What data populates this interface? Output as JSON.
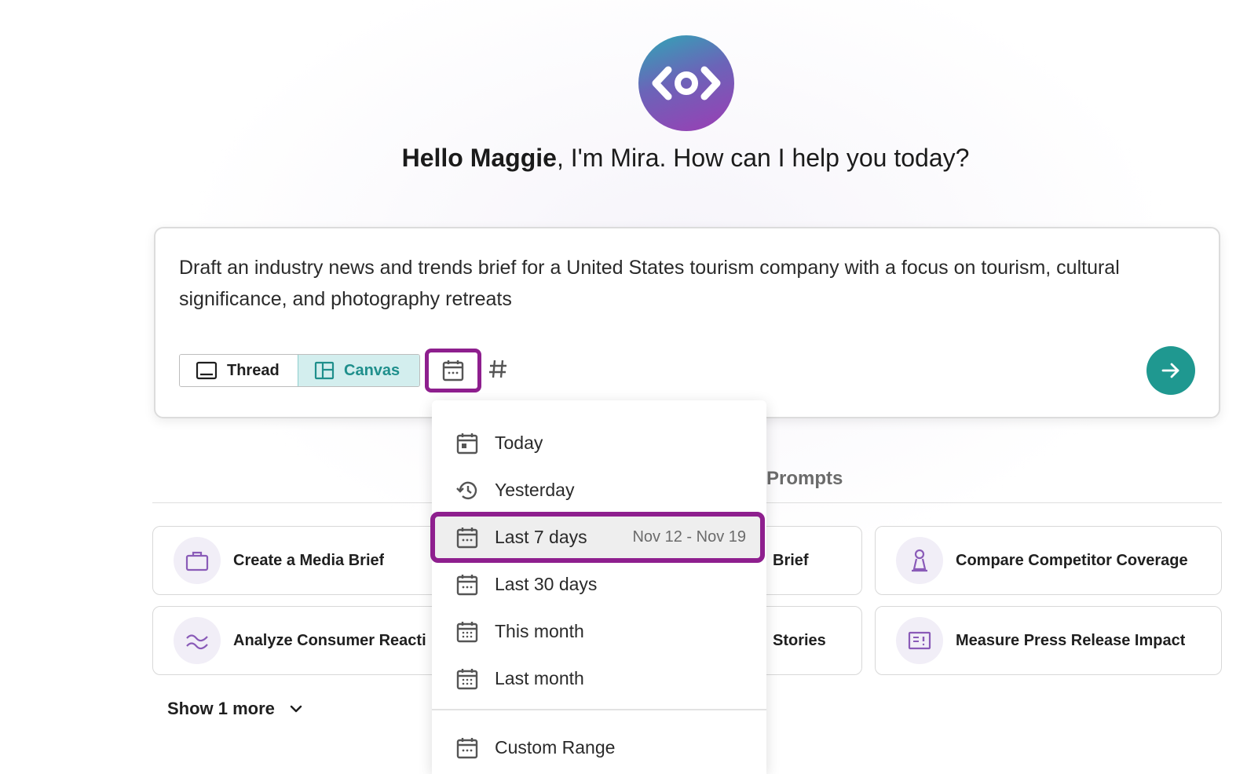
{
  "greeting": {
    "name": "Hello Maggie",
    "rest": ", I'm Mira. How can I help you today?"
  },
  "composer": {
    "text": "Draft an industry news and trends brief for a United States tourism company with a focus on tourism, cultural significance, and photography retreats",
    "thread_label": "Thread",
    "canvas_label": "Canvas"
  },
  "prompts_title": "Prompts",
  "cards": [
    {
      "label": "Create a Media Brief",
      "icon": "briefcase-icon"
    },
    {
      "label": "Brief",
      "icon": ""
    },
    {
      "label": "Compare Competitor Coverage",
      "icon": "chess-pawn-icon"
    },
    {
      "label": "Analyze Consumer Reacti",
      "icon": "wave-icon"
    },
    {
      "label": "Stories",
      "icon": ""
    },
    {
      "label": "Measure Press Release Impact",
      "icon": "press-release-icon"
    }
  ],
  "show_more": "Show 1 more",
  "date_menu": {
    "items": [
      {
        "label": "Today",
        "icon": "calendar-today-icon"
      },
      {
        "label": "Yesterday",
        "icon": "history-icon"
      },
      {
        "label": "Last 7 days",
        "sub": "Nov 12 - Nov 19",
        "icon": "calendar-icon",
        "selected": true
      },
      {
        "label": "Last 30 days",
        "icon": "calendar-icon"
      },
      {
        "label": "This month",
        "icon": "calendar-grid-icon"
      },
      {
        "label": "Last month",
        "icon": "calendar-grid-icon"
      }
    ],
    "custom_range": "Custom Range"
  },
  "colors": {
    "accent": "#1f9890",
    "highlight": "#8e1f8e",
    "canvas_bg": "#d3eeee"
  }
}
